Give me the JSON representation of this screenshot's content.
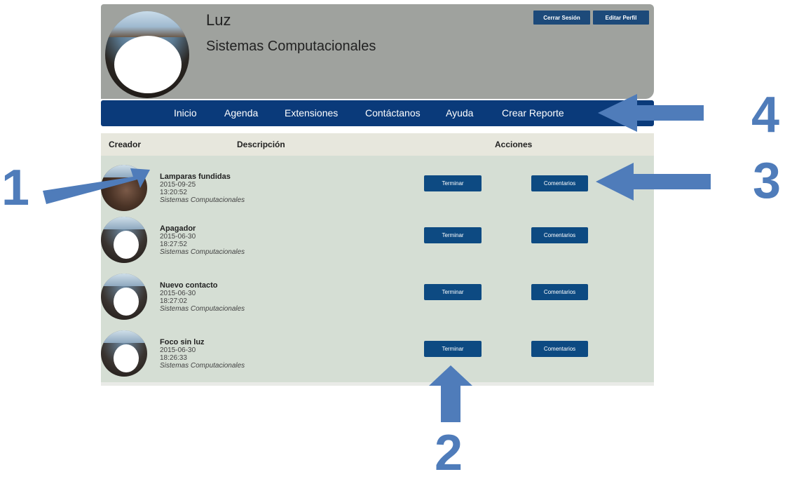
{
  "header": {
    "user_name": "Luz",
    "department": "Sistemas Computacionales",
    "logout_label": "Cerrar Sesión",
    "edit_profile_label": "Editar Perfil"
  },
  "nav": {
    "items": [
      "Inicio",
      "Agenda",
      "Extensiones",
      "Contáctanos",
      "Ayuda",
      "Crear Reporte"
    ]
  },
  "table": {
    "columns": {
      "creator": "Creador",
      "description": "Descripción",
      "actions": "Acciones"
    },
    "finish_label": "Terminar",
    "comments_label": "Comentarios",
    "rows": [
      {
        "title": "Lamparas fundidas",
        "date": "2015-09-25",
        "time": "13:20:52",
        "department": "Sistemas Computacionales"
      },
      {
        "title": "Apagador",
        "date": "2015-06-30",
        "time": "18:27:52",
        "department": "Sistemas Computacionales"
      },
      {
        "title": "Nuevo contacto",
        "date": "2015-06-30",
        "time": "18:27:02",
        "department": "Sistemas Computacionales"
      },
      {
        "title": "Foco sin luz",
        "date": "2015-06-30",
        "time": "18:26:33",
        "department": "Sistemas Computacionales"
      }
    ]
  },
  "callouts": [
    "1",
    "2",
    "3",
    "4"
  ],
  "colors": {
    "nav_bg": "#0a3a7a",
    "button_bg": "#0d4a82",
    "header_bg": "#9fa29e",
    "rows_bg": "#d5ded4",
    "callout": "#4f7cba"
  },
  "icons": [
    "user-avatar-icon"
  ]
}
